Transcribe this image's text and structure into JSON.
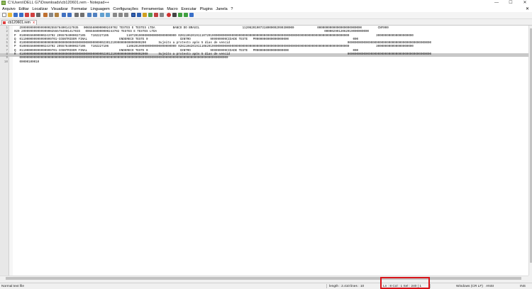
{
  "window": {
    "title": "C:\\Users\\DELL G7\\Downloads\\cb120601.rem - Notepad++",
    "minimize": "—",
    "maximize": "☐",
    "close": "✕"
  },
  "menu": [
    "Arquivo",
    "Editar",
    "Localizar",
    "Visualizar",
    "Formatar",
    "Linguagem",
    "Configurações",
    "Ferramentas",
    "Macro",
    "Executar",
    "Plugins",
    "Janela",
    "?"
  ],
  "menu_close": "✕",
  "tab": {
    "label": "cb120601.rem",
    "close": "x"
  },
  "editor": {
    "lines": [
      {
        "n": "1",
        "text": "   299999999999999002555784001417035   0065560000000249702 TESTES E TESTES LTDA          BANCO DO BRASIL                        11206201907318000002990300000             0000000000000000000000000         CNF000"
      },
      {
        "n": "2",
        "text": "020 20999999999999900255578400141703S   0065560000000243702 TESTES E TESTES LTDA                                                                                              0000029912062019000000000"
      },
      {
        "n": "3",
        "text": "P  01006556000000243702 2055784000027105   7102227105          1107201900000000000000000000 02N110620191110720190000000000000000000000000000000000000000000000000000000000000000000000000000               300000000090000000000"
      },
      {
        "n": "4",
        "text": "Q  011000099999999999701-COSNTRIDOR FINAL                  ENDERECO TESTE 0                  CENTRO           999999999CIDADE TESTE   PR000000000000000000                                    000"
      },
      {
        "n": "5",
        "text": "R  01000000000000000000000000000000000000000000000230121999000000000000200       Sujeito a protesto após 5 dias de vencid                                                                  00000000000000000000000000000000000000000000000"
      },
      {
        "n": "6",
        "text": "P  01005556000000243702 2055784000027106   7102227106          1108201900000000000000000000 02N110820191110820190000000000000000000000000000000000000000000000000000000000000000000000000000               300000000090000000000"
      },
      {
        "n": "7",
        "text": "Q  011000099999999999701-COSNTRIDOR FINAL                  ENDERECO TESTE 0                  CENTRO           999999999CIDADE TESTE   PR000000000000000000                                    000"
      },
      {
        "n": "8",
        "text": "R  010000000000000000000000000000000000000000000002301219990000000000002000      Sujeito a protesto após 5 dias de vencid                                                                  00000000000000000000000000000000000000000000000"
      },
      {
        "n": "9",
        "text": "   000000000000000000000000000000000000000000000000000000000000000000000000000000000000000000000000000000000000000000000"
      },
      {
        "n": "10",
        "text": "   00000100010"
      }
    ]
  },
  "status": {
    "file_type": "Normal text file",
    "length": "length : 2.410",
    "lines": "lines : 10",
    "position": "Ln : 8    Col : 1    Sel : 240 | 1",
    "eol": "Windows (CR LF)",
    "encoding": "ANSI",
    "mode": "INS"
  },
  "colors": {
    "highlight_box": "#d8141a",
    "current_line": "#c8c8c8"
  }
}
